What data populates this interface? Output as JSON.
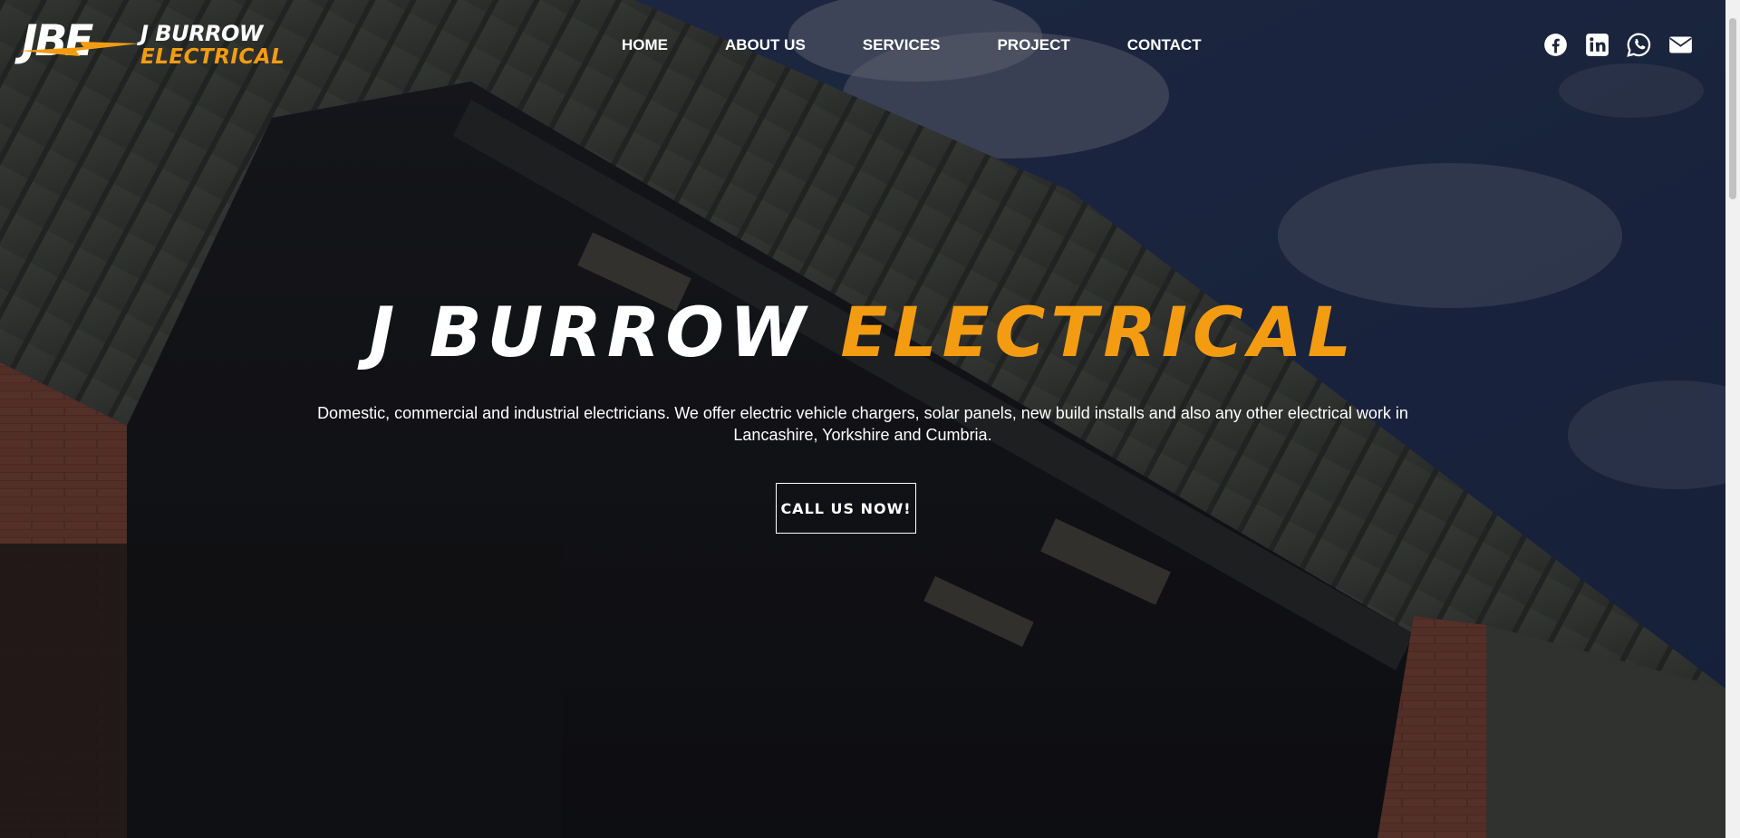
{
  "brand": {
    "logo_mark": "JBE",
    "name_line1": "J BURROW",
    "name_line2": "ELECTRICAL",
    "accent_color": "#f39c12"
  },
  "nav": {
    "items": [
      "HOME",
      "ABOUT US",
      "SERVICES",
      "PROJECT",
      "CONTACT"
    ]
  },
  "social": {
    "icons": [
      "facebook-icon",
      "linkedin-icon",
      "whatsapp-icon",
      "email-icon"
    ]
  },
  "hero": {
    "title_part1": "J BURROW",
    "title_part2": "ELECTRICAL",
    "description": "Domestic, commercial and industrial electricians. We offer electric vehicle chargers, solar panels, new build installs and also any other electrical work in Lancashire, Yorkshire and Cumbria.",
    "cta_label": "CALL US NOW!"
  }
}
